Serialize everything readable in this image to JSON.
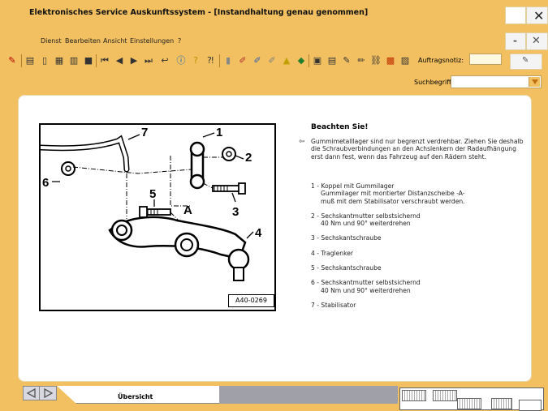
{
  "window": {
    "title": "Elektronisches Service Auskunftssystem - [Instandhaltung genau genommen]"
  },
  "menu": {
    "items": [
      "Dienst",
      "Bearbeiten",
      "Ansicht",
      "Einstellungen",
      "?"
    ]
  },
  "toolbar": {
    "order_note_label": "Auftragsnotiz:",
    "order_note_value": ""
  },
  "search": {
    "label": "Suchbegriff:",
    "value": ""
  },
  "figure": {
    "reference": "A40-0269",
    "callouts": [
      "1",
      "2",
      "3",
      "4",
      "5",
      "6",
      "7",
      "A"
    ]
  },
  "note": {
    "title": "Beachten Sie!",
    "text": "Gummimetalllager sind nur begrenzt verdrehbar. Ziehen Sie deshalb die Schraubverbindungen an den Achslenkern der Radaufhängung erst dann fest, wenn das Fahrzeug auf den Rädern steht."
  },
  "legend": [
    {
      "label": "1 - Koppel mit Gummilager",
      "sub": [
        "Gummilager mit montierter Distanzscheibe -A-",
        "muß mit dem Stabilisator verschraubt werden."
      ]
    },
    {
      "label": "2 - Sechskantmutter selbstsichernd",
      "sub": [
        "40 Nm und 90° weiterdrehen"
      ]
    },
    {
      "label": "3 - Sechskantschraube",
      "sub": []
    },
    {
      "label": "4 - Traglenker",
      "sub": []
    },
    {
      "label": "5 - Sechskantschraube",
      "sub": []
    },
    {
      "label": "6 - Sechskantmutter selbstsichernd",
      "sub": [
        "40 Nm und 90° weiterdrehen"
      ]
    },
    {
      "label": "7 - Stabilisator",
      "sub": []
    }
  ],
  "tabs": {
    "overview": "Übersicht"
  },
  "colors": {
    "chrome": "#f2c060",
    "content_bg": "#ffffff"
  }
}
